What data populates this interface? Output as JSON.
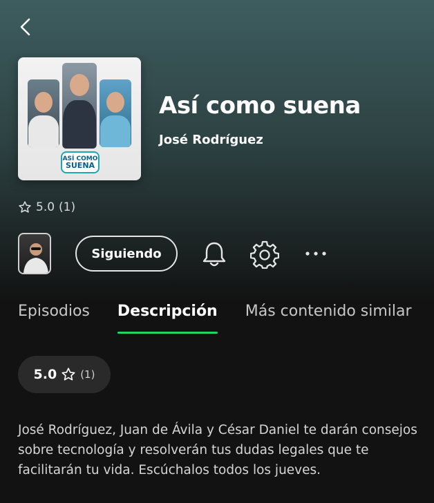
{
  "header": {
    "back_icon": "chevron-left-icon"
  },
  "podcast": {
    "title": "Así como suena",
    "author": "José Rodríguez",
    "cover_logo_line1": "ASÍ COMO",
    "cover_logo_line2": "SUENA"
  },
  "rating": {
    "value": "5.0",
    "count": "(1)"
  },
  "actions": {
    "follow_label": "Siguiendo",
    "bell_icon": "bell-icon",
    "settings_icon": "gear-icon",
    "more_icon": "more-dots-icon"
  },
  "tabs": [
    {
      "label": "Episodios",
      "active": false
    },
    {
      "label": "Descripción",
      "active": true
    },
    {
      "label": "Más contenido similar",
      "active": false
    }
  ],
  "rating_pill": {
    "value": "5.0",
    "count": "(1)"
  },
  "description": "José Rodríguez, Juan de Ávila y César Daniel te darán consejos sobre tecnología y resolverán tus dudas legales que te facilitarán tu vida. Escúchalos todos los jueves.",
  "colors": {
    "accent": "#1ed760",
    "background": "#121212",
    "header_gradient_top": "#3e5d5f"
  }
}
